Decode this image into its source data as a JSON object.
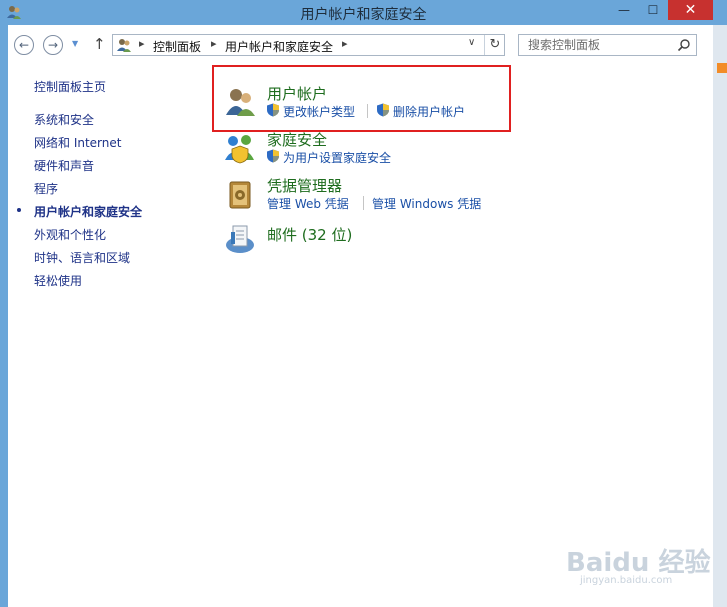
{
  "window": {
    "title": "用户帐户和家庭安全",
    "minimize_glyph": "—",
    "maximize_glyph": "☐",
    "close_glyph": "✕"
  },
  "nav": {
    "back_glyph": "←",
    "forward_glyph": "→",
    "recent_glyph": "▼",
    "up_glyph": "↑",
    "separator": "▸",
    "breadcrumbs": [
      "控制面板",
      "用户帐户和家庭安全"
    ],
    "dropdown_glyph": "∨",
    "refresh_glyph": "↻",
    "search_placeholder": "搜索控制面板"
  },
  "sidebar": {
    "home": "控制面板主页",
    "items": [
      "系统和安全",
      "网络和 Internet",
      "硬件和声音",
      "程序",
      "用户帐户和家庭安全",
      "外观和个性化",
      "时钟、语言和区域",
      "轻松使用"
    ],
    "active_index": 4
  },
  "categories": [
    {
      "title": "用户帐户",
      "icon": "user-accounts-icon",
      "links": [
        "更改帐户类型",
        "删除用户帐户"
      ]
    },
    {
      "title": "家庭安全",
      "icon": "family-safety-icon",
      "links": [
        "为用户设置家庭安全"
      ]
    },
    {
      "title": "凭据管理器",
      "icon": "credential-manager-icon",
      "links": [
        "管理 Web 凭据",
        "管理 Windows 凭据"
      ]
    },
    {
      "title": "邮件 (32 位)",
      "icon": "mail-icon",
      "links": []
    }
  ],
  "watermark": {
    "text": "Baidu 经验",
    "sub": "jingyan.baidu.com"
  },
  "colors": {
    "title_bar": "#6aa6d9",
    "close_button": "#c7312f",
    "category_title": "#1e6c1e",
    "link": "#1a4fa6",
    "sidebar_link": "#1e3287",
    "highlight_box": "#e02020"
  }
}
